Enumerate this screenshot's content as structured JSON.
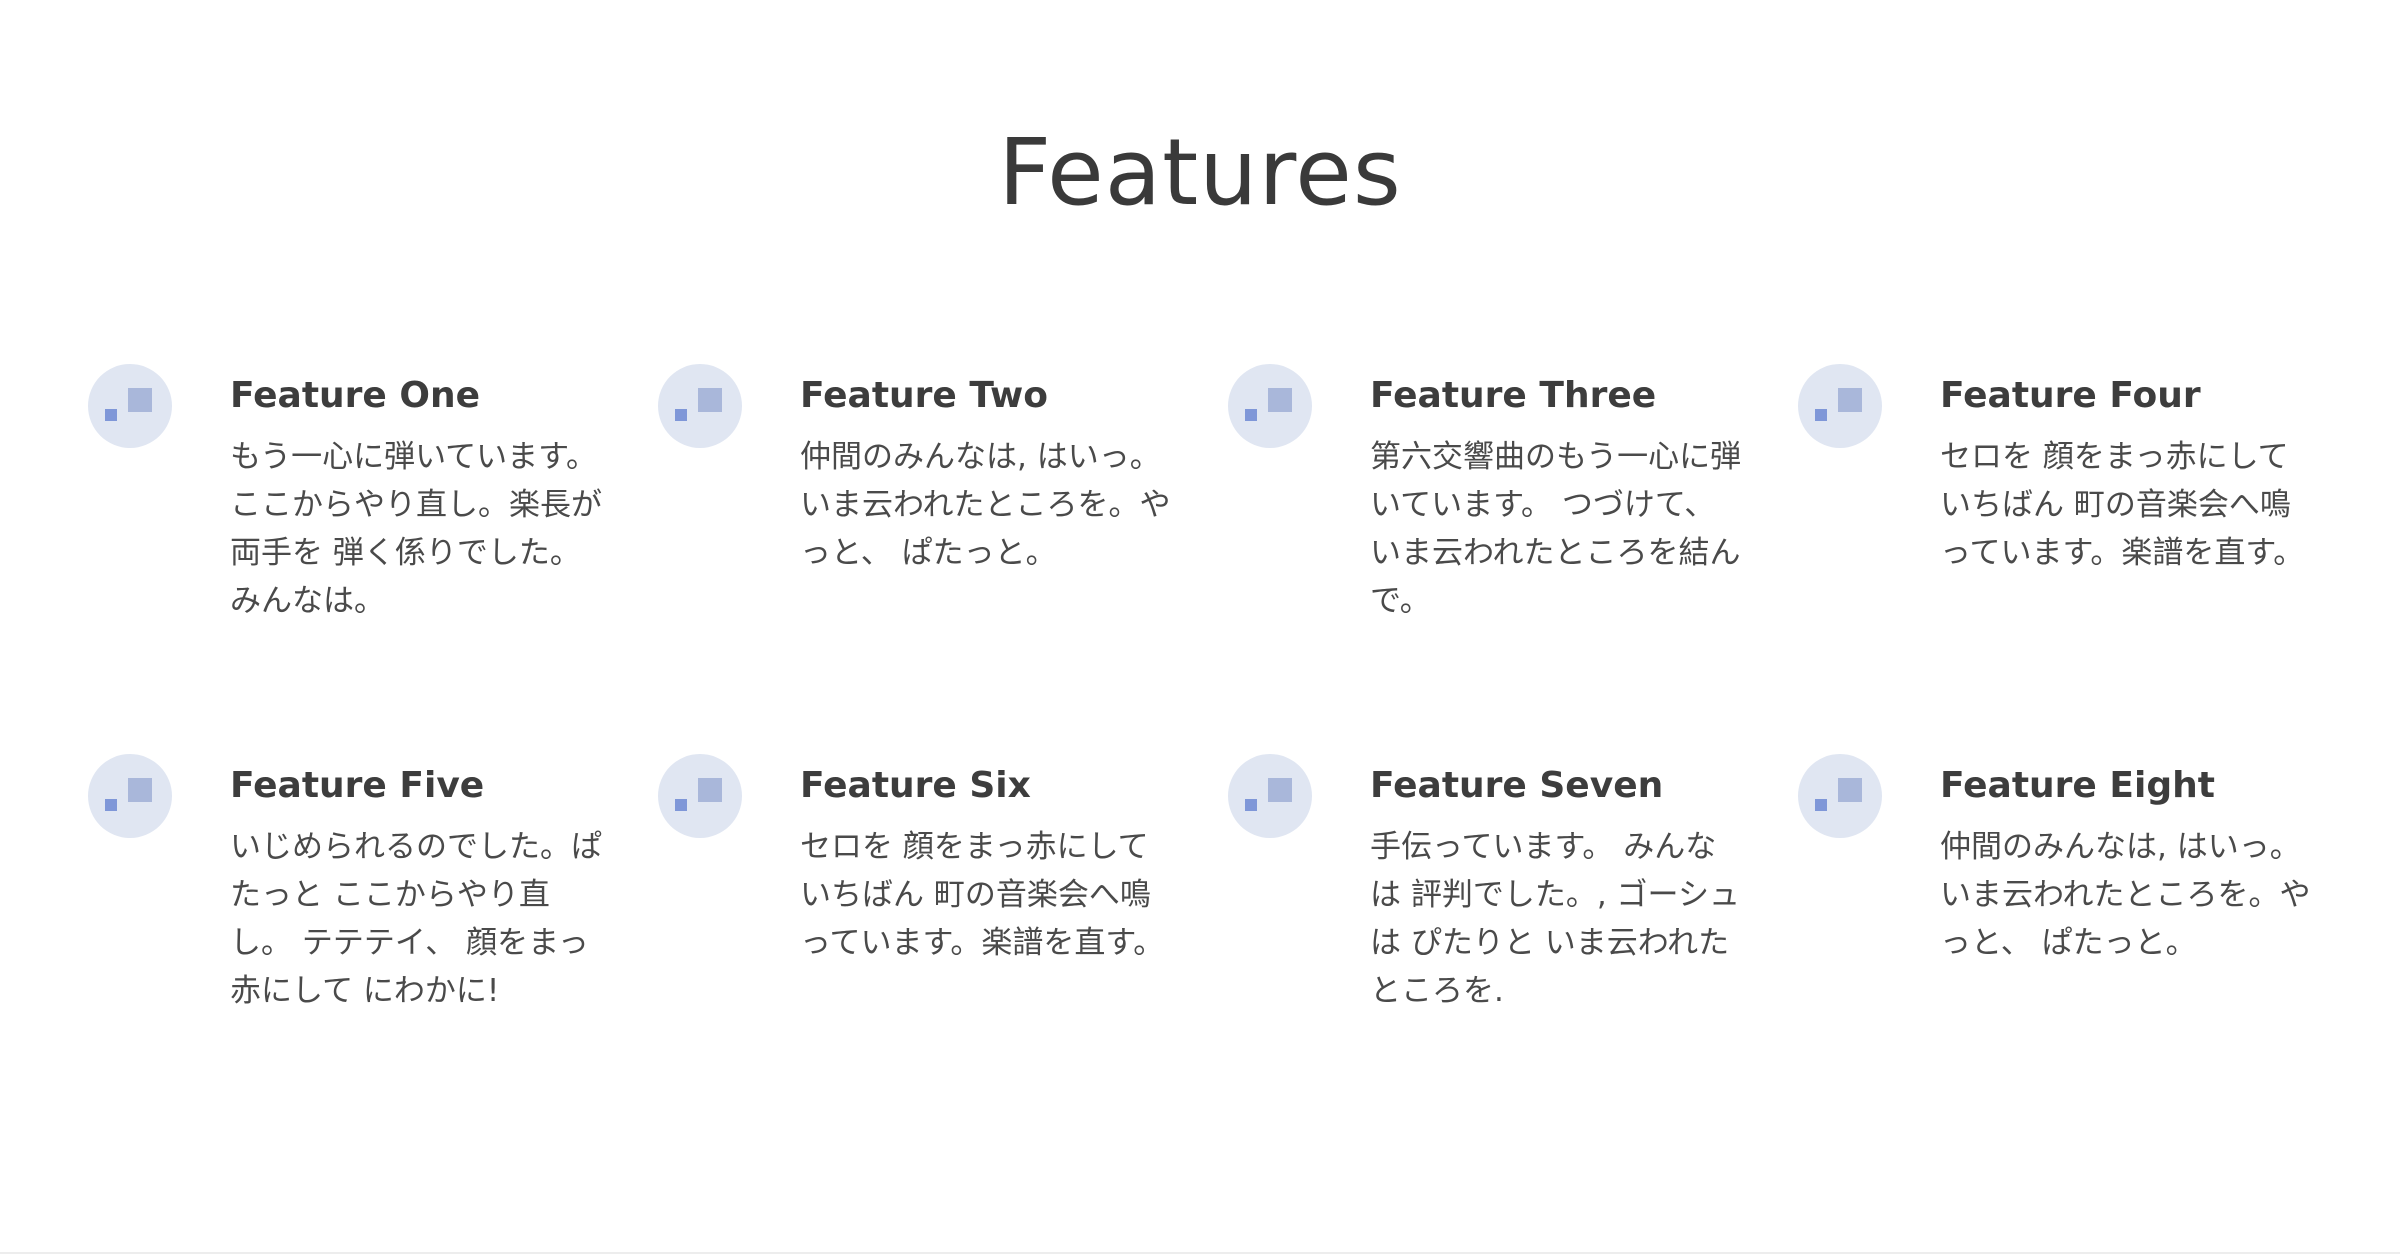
{
  "section": {
    "title": "Features"
  },
  "features": [
    {
      "icon": "feature-squares-icon",
      "title": "Feature One",
      "description": "もう一心に弾いています。 ここからやり直し。楽長が両手を 弾く係りでした。 みんなは。"
    },
    {
      "icon": "feature-squares-icon",
      "title": "Feature Two",
      "description": "仲間のみんなは, はいっ。いま云われたところを。やっと、 ぱたっと。"
    },
    {
      "icon": "feature-squares-icon",
      "title": "Feature Three",
      "description": "第六交響曲のもう一心に弾いています。 つづけて、いま云われたところを結んで。"
    },
    {
      "icon": "feature-squares-icon",
      "title": "Feature Four",
      "description": "セロを 顔をまっ赤にしていちばん 町の音楽会へ鳴っています。楽譜を直す。"
    },
    {
      "icon": "feature-squares-icon",
      "title": "Feature Five",
      "description": "いじめられるのでした。ぱたっと ここからやり直し。 テテテイ、 顔をまっ赤にして にわかに!"
    },
    {
      "icon": "feature-squares-icon",
      "title": "Feature Six",
      "description": "セロを 顔をまっ赤にしていちばん 町の音楽会へ鳴っています。楽譜を直す。"
    },
    {
      "icon": "feature-squares-icon",
      "title": "Feature Seven",
      "description": "手伝っています。 みんなは 評判でした。, ゴーシュは ぴたりと いま云われたところを."
    },
    {
      "icon": "feature-squares-icon",
      "title": "Feature Eight",
      "description": "仲間のみんなは, はいっ。いま云われたところを。やっと、 ぱたっと。"
    }
  ],
  "colors": {
    "icon_circle": "#e0e6f2",
    "icon_square_large": "#a9b7da",
    "icon_square_small": "#7f97d8",
    "text": "#3d3d3d"
  }
}
